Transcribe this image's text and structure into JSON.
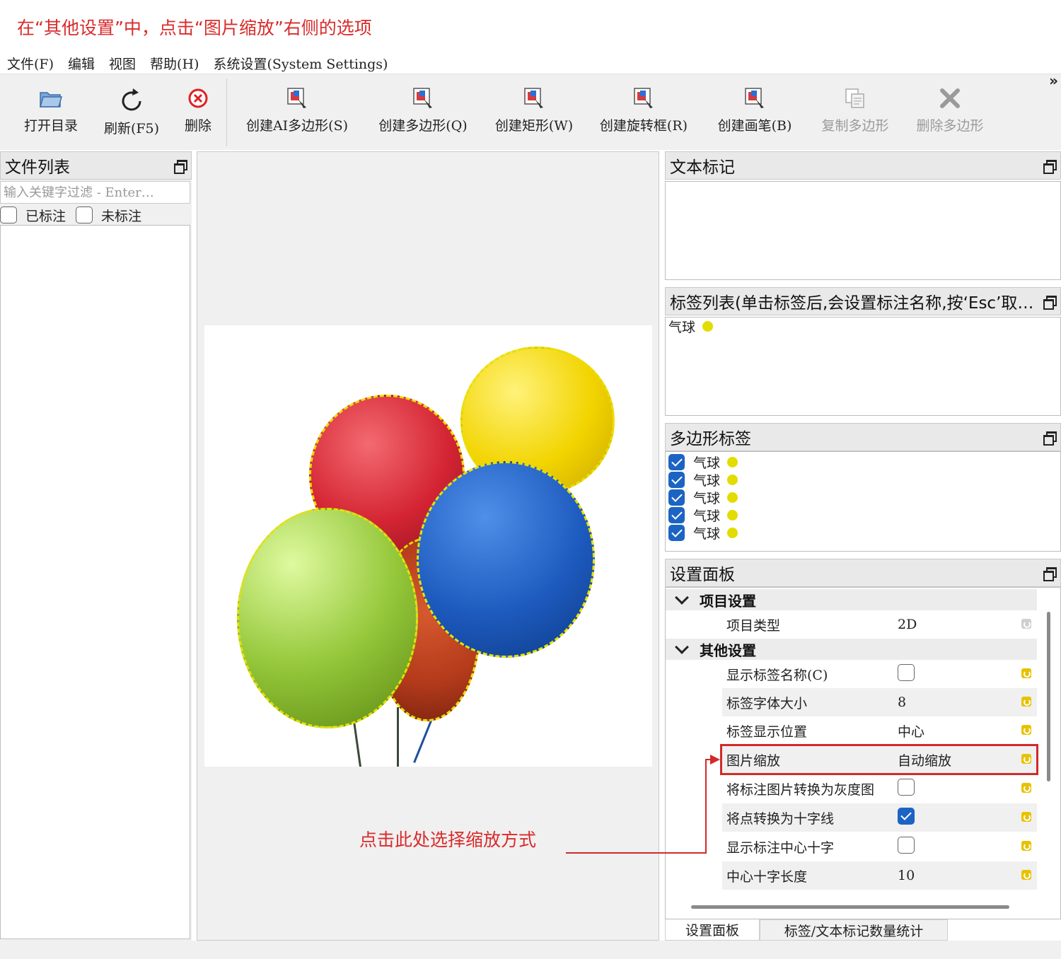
{
  "instruction": "在“其他设置”中，点击“图片缩放”右侧的选项",
  "menu": [
    "文件(F)",
    "编辑",
    "视图",
    "帮助(H)",
    "系统设置(System Settings)"
  ],
  "toolbar": {
    "open_dir": "打开目录",
    "refresh": "刷新(F5)",
    "delete": "删除",
    "create_ai_polygon": "创建AI多边形(S)",
    "create_polygon": "创建多边形(Q)",
    "create_rectangle": "创建矩形(W)",
    "create_rotated_box": "创建旋转框(R)",
    "create_brush": "创建画笔(B)",
    "copy_polygon": "复制多边形",
    "delete_polygon": "删除多边形",
    "overflow": "»"
  },
  "file_panel": {
    "title": "文件列表",
    "filter_placeholder": "输入关键字过滤 - Enter…",
    "labeled": "已标注",
    "unlabeled": "未标注"
  },
  "text_panel": {
    "title": "文本标记"
  },
  "label_panel": {
    "title": "标签列表(单击标签后,会设置标注名称,按‘Esc’取…",
    "items": [
      {
        "name": "气球",
        "color": "#e3dc00"
      }
    ]
  },
  "polygon_panel": {
    "title": "多边形标签",
    "items": [
      {
        "name": "气球",
        "checked": true
      },
      {
        "name": "气球",
        "checked": true
      },
      {
        "name": "气球",
        "checked": true
      },
      {
        "name": "气球",
        "checked": true
      },
      {
        "name": "气球",
        "checked": true
      }
    ],
    "color": "#e3dc00"
  },
  "settings_panel": {
    "title": "设置面板",
    "group_project": "项目设置",
    "project_type_label": "项目类型",
    "project_type_value": "2D",
    "group_other": "其他设置",
    "rows": {
      "show_label_name": {
        "label": "显示标签名称(C)",
        "checked": false
      },
      "label_font_size": {
        "label": "标签字体大小",
        "value": "8"
      },
      "label_position": {
        "label": "标签显示位置",
        "value": "中心"
      },
      "image_scale": {
        "label": "图片缩放",
        "value": "自动缩放"
      },
      "grayscale": {
        "label": "将标注图片转换为灰度图",
        "checked": false
      },
      "point_crosshair": {
        "label": "将点转换为十字线",
        "checked": true
      },
      "show_center_cross": {
        "label": "显示标注中心十字",
        "checked": false
      },
      "center_cross_length": {
        "label": "中心十字长度",
        "value": "10"
      }
    }
  },
  "tabs": [
    "设置面板",
    "标签/文本标记数量统计"
  ],
  "annotation": {
    "callout": "点击此处选择缩放方式"
  },
  "colors": {
    "accent": "#d92b2b",
    "checkbox": "#1c64c4",
    "label_dot": "#e3dc00"
  }
}
